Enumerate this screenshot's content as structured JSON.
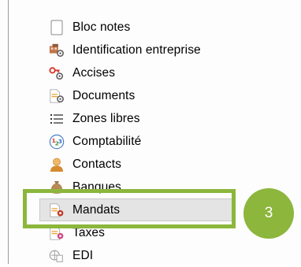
{
  "menu": {
    "items": [
      {
        "label": "Bloc notes",
        "icon": "blank-page-icon"
      },
      {
        "label": "Identification entreprise",
        "icon": "company-settings-icon"
      },
      {
        "label": "Accises",
        "icon": "excise-settings-icon"
      },
      {
        "label": "Documents",
        "icon": "document-settings-icon"
      },
      {
        "label": "Zones libres",
        "icon": "list-icon"
      },
      {
        "label": "Comptabilité",
        "icon": "numbers-icon"
      },
      {
        "label": "Contacts",
        "icon": "contact-person-icon"
      },
      {
        "label": "Banques",
        "icon": "money-bag-icon"
      },
      {
        "label": "Mandats",
        "icon": "mandate-document-icon",
        "selected": true
      },
      {
        "label": "Taxes",
        "icon": "tax-document-icon"
      },
      {
        "label": "EDI",
        "icon": "edi-icon"
      }
    ]
  },
  "callout": {
    "number": "3"
  },
  "colors": {
    "highlight": "#8cb63c",
    "selected_bg": "#e4e4e4"
  }
}
